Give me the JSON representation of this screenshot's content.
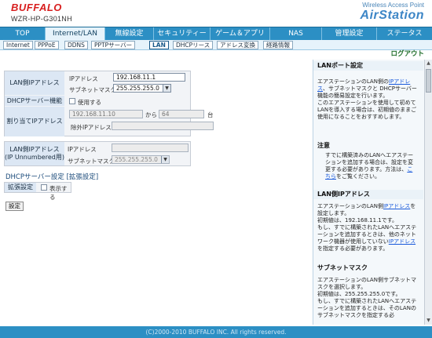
{
  "brand": "BUFFALO",
  "model": "WZR-HP-G301NH",
  "wap": "Wireless Access Point",
  "airstation": "AirStation",
  "main_tabs": [
    "TOP",
    "Internet/LAN",
    "無線設定",
    "セキュリティー",
    "ゲーム＆アプリ",
    "NAS",
    "管理設定",
    "ステータス"
  ],
  "sub_tabs": [
    "Internet",
    "PPPoE",
    "DDNS",
    "PPTPサーバー",
    "LAN",
    "DHCPリース",
    "アドレス変換",
    "経路情報"
  ],
  "logout": "ログアウト",
  "lan_ip": {
    "label": "LAN側IPアドレス",
    "ip_label": "IPアドレス",
    "ip_value": "192.168.11.1",
    "mask_label": "サブネットマスク",
    "mask_value": "255.255.255.0"
  },
  "dhcp": {
    "label": "DHCPサーバー機能",
    "use_label": "使用する"
  },
  "assign": {
    "label": "割り当てIPアドレス",
    "start": "192.168.11.10",
    "from": "から",
    "count": "64",
    "unit": "台",
    "exclude_label": "除外IPアドレス:"
  },
  "unnumbered": {
    "label1": "LAN側IPアドレス",
    "label2": "(IP Unnumbered用)",
    "ip_label": "IPアドレス",
    "mask_label": "サブネットマスク",
    "mask_value": "255.255.255.0"
  },
  "dhcp_ext": {
    "title": "DHCPサーバー設定 [拡張設定]",
    "label": "拡張設定",
    "show_label": "表示する"
  },
  "apply_button": "設定",
  "help": {
    "s1_title": "LANポート設定",
    "s1_p1": "エアステーションのLAN側の",
    "s1_link1": "IPアドレス",
    "s1_p2": "、サブネットマスクと DHCPサーバー機能の簡易設定を行います。",
    "s1_p3": "このエアステーションを使用して初めてLANを導入する場合は、初期値のままご使用になることをおすすめします。",
    "note_title": "注意",
    "note_p": "すでに構築済みのLANへエアステーションを追加する場合は、設定を変更する必要があります。方法は、",
    "note_link": "こちら",
    "note_p2": "をご覧ください。",
    "s2_title": "LAN側IPアドレス",
    "s2_p1": "エアステーションのLAN側",
    "s2_link1": "IPアドレス",
    "s2_p2": "を設定します。",
    "s2_p3": "初期値は、192.168.11.1です。",
    "s2_p4": "もし、すでに構築されたLANへエアステーションを追加するときは、他のネットワーク機器が使用していない",
    "s2_link2": "IPアドレス",
    "s2_p5": "を指定する必要があります。",
    "s3_title": "サブネットマスク",
    "s3_p1": "エアステーションのLAN側サブネットマスクを選択します。",
    "s3_p2": "初期値は、255.255.255.0です。",
    "s3_p3": "もし、すでに構築されたLANへエアステーションを追加するときは、そのLANのサブネットマスクを指定する必"
  },
  "footer": "(C)2000-2010 BUFFALO INC. All rights reserved."
}
